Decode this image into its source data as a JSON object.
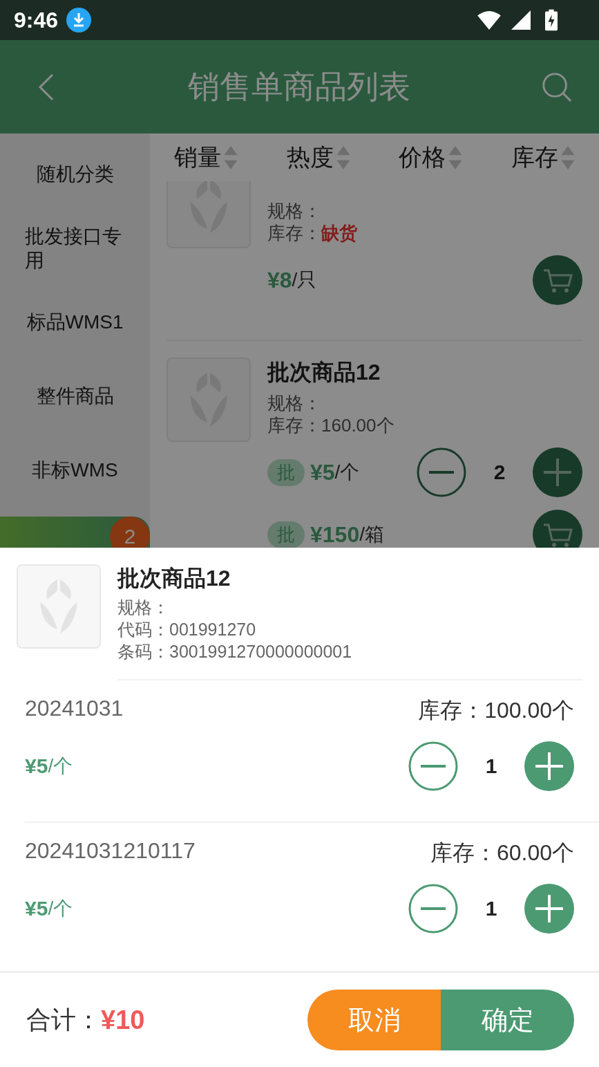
{
  "status_bar": {
    "time": "9:46"
  },
  "header": {
    "title": "销售单商品列表"
  },
  "sort_tabs": [
    {
      "label": "销量"
    },
    {
      "label": "热度"
    },
    {
      "label": "价格"
    },
    {
      "label": "库存"
    }
  ],
  "sidebar": {
    "items": [
      {
        "label": "随机分类",
        "selected": false
      },
      {
        "label": "批发接口专用",
        "selected": false
      },
      {
        "label": "标品WMS1",
        "selected": false
      },
      {
        "label": "整件商品",
        "selected": false
      },
      {
        "label": "非标WMS",
        "selected": false
      }
    ],
    "cart_badge": "2"
  },
  "products": [
    {
      "spec": "规格：",
      "stock_label": "库存：",
      "stock": "缺货",
      "out_of_stock": true,
      "prices": [
        {
          "kind": "cart",
          "price": "¥8",
          "unit": "/只"
        }
      ]
    },
    {
      "name": "批次商品12",
      "spec": "规格：",
      "stock_label": "库存：",
      "stock": "160.00个",
      "out_of_stock": false,
      "prices": [
        {
          "kind": "stepper",
          "tag": "批",
          "price": "¥5",
          "unit": "/个",
          "qty": "2"
        },
        {
          "kind": "cart",
          "tag": "批",
          "price": "¥150",
          "unit": "/箱"
        }
      ]
    }
  ],
  "sheet": {
    "name": "批次商品12",
    "spec": "规格：",
    "code": "代码：001991270",
    "barcode": "条码：3001991270000000001",
    "batches": [
      {
        "batch": "20241031",
        "stock": "库存：100.00个",
        "price": "¥5",
        "unit": "/个",
        "qty": "1"
      },
      {
        "batch": "20241031210117",
        "stock": "库存：60.00个",
        "price": "¥5",
        "unit": "/个",
        "qty": "1"
      }
    ],
    "total_label": "合计：",
    "total": "¥10",
    "cancel": "取消",
    "confirm": "确定"
  }
}
